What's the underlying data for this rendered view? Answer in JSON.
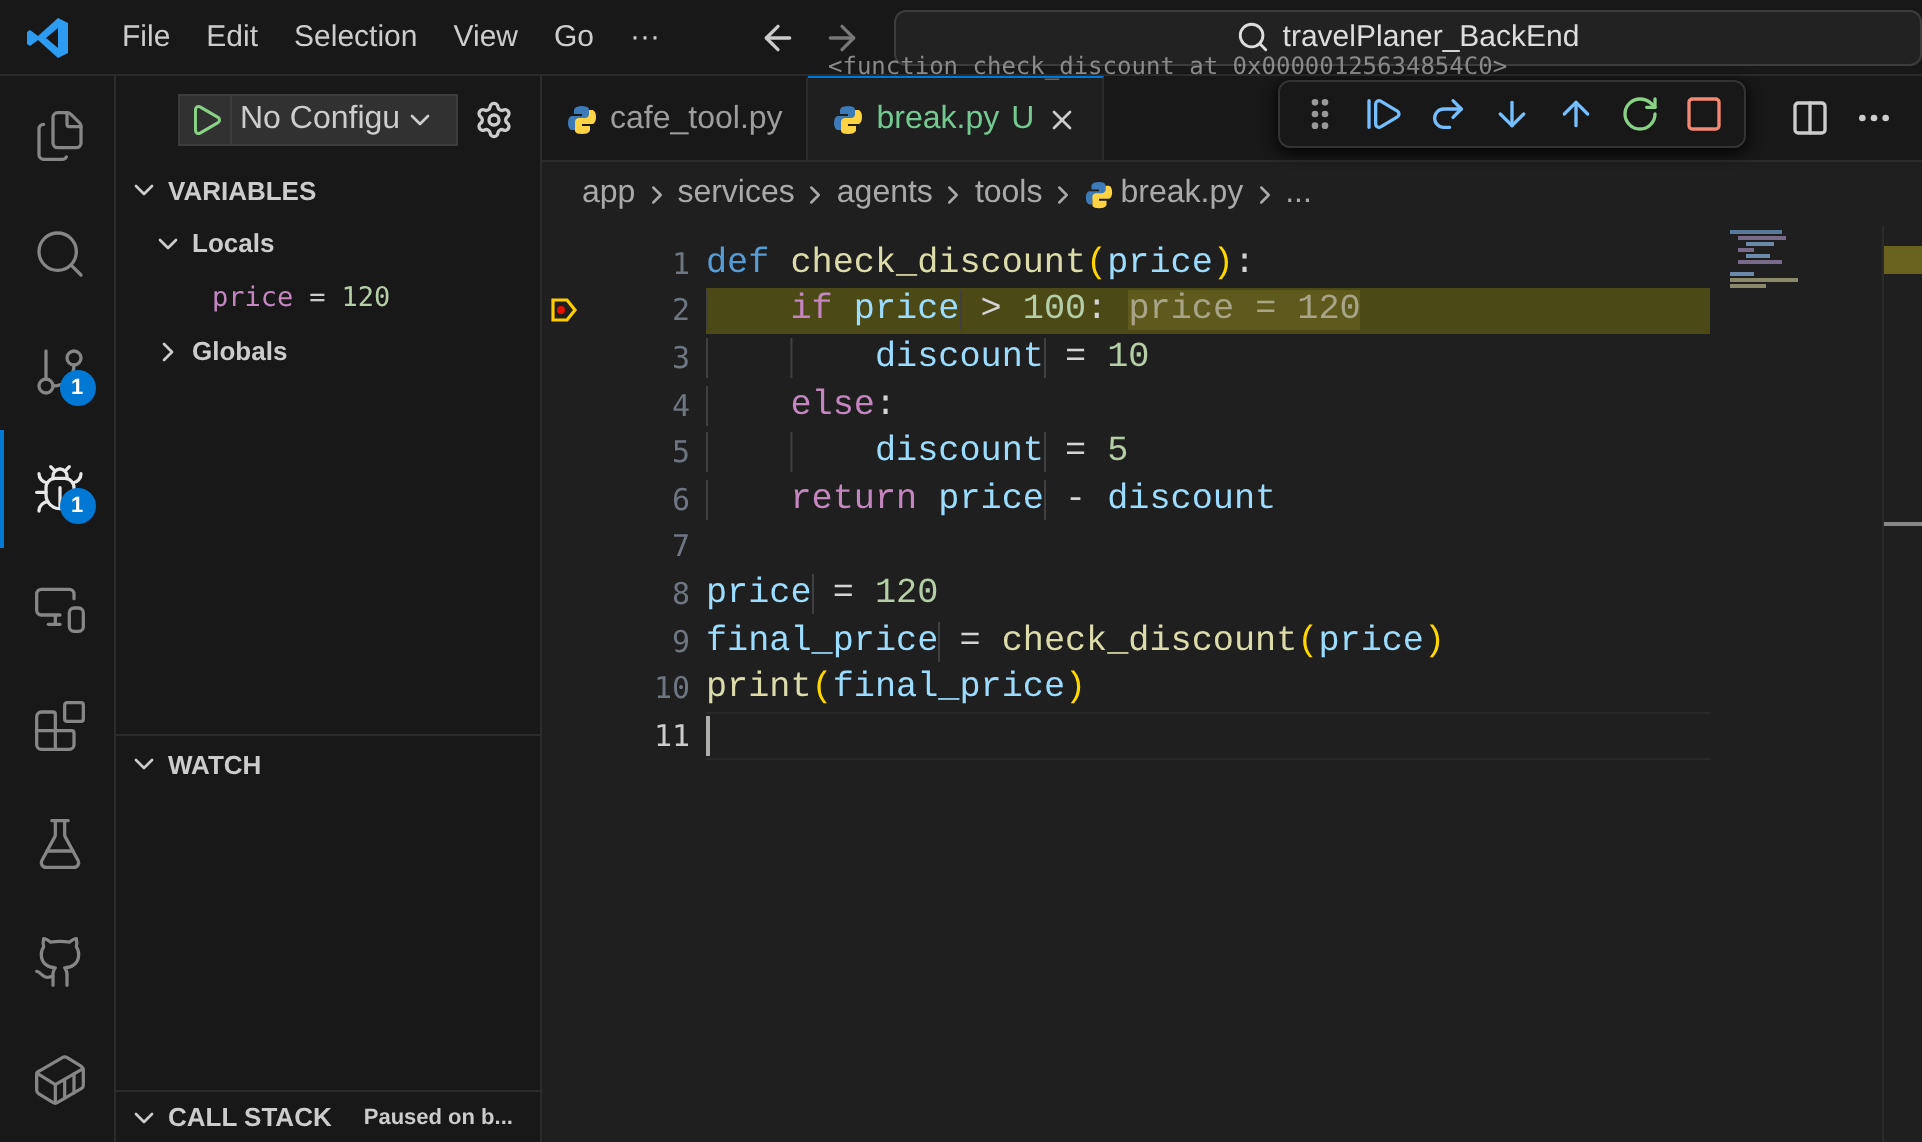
{
  "menu": [
    "File",
    "Edit",
    "Selection",
    "View",
    "Go",
    "···"
  ],
  "search": {
    "value": "travelPlaner_BackEnd"
  },
  "activity_bar": [
    {
      "kind": "explorer",
      "selected": false
    },
    {
      "kind": "search",
      "selected": false
    },
    {
      "kind": "source-control",
      "selected": false,
      "badge": "1"
    },
    {
      "kind": "run-debug",
      "selected": true,
      "badge": "1"
    },
    {
      "kind": "remote",
      "selected": false
    },
    {
      "kind": "extensions",
      "selected": false
    },
    {
      "kind": "testing",
      "selected": false
    },
    {
      "kind": "github",
      "selected": false
    },
    {
      "kind": "docker",
      "selected": false
    }
  ],
  "run_config": {
    "label": "No Configu"
  },
  "variables": {
    "title": "VARIABLES",
    "expanded": true,
    "scopes": [
      {
        "name": "Locals",
        "expanded": true,
        "children": [
          {
            "name": "price",
            "operator": "=",
            "value": "120"
          }
        ]
      },
      {
        "name": "Globals",
        "expanded": false
      }
    ]
  },
  "watch": {
    "title": "WATCH",
    "expanded": true
  },
  "call_stack": {
    "title": "CALL STACK",
    "expanded": true,
    "status": "Paused on b..."
  },
  "tabs": [
    {
      "label": "cafe_tool.py",
      "selected": false
    },
    {
      "label": "break.py",
      "selected": true,
      "status": "U"
    }
  ],
  "breadcrumbs": [
    "app",
    "services",
    "agents",
    "tools",
    "break.py",
    "..."
  ],
  "hover": {
    "text": "<function check_discount at 0x00000125634854C0>"
  },
  "debug_toolbar": [
    {
      "kind": "drag"
    },
    {
      "kind": "continue"
    },
    {
      "kind": "step-over"
    },
    {
      "kind": "step-into"
    },
    {
      "kind": "step-out"
    },
    {
      "kind": "restart"
    },
    {
      "kind": "stop"
    }
  ],
  "code": [
    {
      "number": "1",
      "current": false,
      "breakpoint": false,
      "cursor": false,
      "tokens": [
        {
          "kind": "kw",
          "text": "def "
        },
        {
          "kind": "fn",
          "text": "check_discount"
        },
        {
          "kind": "br",
          "text": "("
        },
        {
          "kind": "var",
          "text": "price"
        },
        {
          "kind": "br",
          "text": ")"
        },
        {
          "kind": "op",
          "text": ":"
        }
      ]
    },
    {
      "number": "2",
      "current": true,
      "breakpoint": true,
      "cursor": false,
      "inline_value": "price = 120",
      "tokens": [
        {
          "kind": "ctl",
          "text": "    if "
        },
        {
          "kind": "var",
          "text": "price"
        },
        {
          "kind": "op",
          "text": " > "
        },
        {
          "kind": "num",
          "text": "100"
        },
        {
          "kind": "op",
          "text": ": "
        }
      ]
    },
    {
      "number": "3",
      "current": false,
      "breakpoint": false,
      "cursor": false,
      "tokens": [
        {
          "kind": "var",
          "text": "        discount"
        },
        {
          "kind": "op",
          "text": " = "
        },
        {
          "kind": "num",
          "text": "10"
        }
      ]
    },
    {
      "number": "4",
      "current": false,
      "breakpoint": false,
      "cursor": false,
      "tokens": [
        {
          "kind": "ctl",
          "text": "    else"
        },
        {
          "kind": "op",
          "text": ":"
        }
      ]
    },
    {
      "number": "5",
      "current": false,
      "breakpoint": false,
      "cursor": false,
      "tokens": [
        {
          "kind": "var",
          "text": "        discount"
        },
        {
          "kind": "op",
          "text": " = "
        },
        {
          "kind": "num",
          "text": "5"
        }
      ]
    },
    {
      "number": "6",
      "current": false,
      "breakpoint": false,
      "cursor": false,
      "tokens": [
        {
          "kind": "ctl",
          "text": "    return "
        },
        {
          "kind": "var",
          "text": "price"
        },
        {
          "kind": "op",
          "text": " - "
        },
        {
          "kind": "var",
          "text": "discount"
        }
      ]
    },
    {
      "number": "7",
      "current": false,
      "breakpoint": false,
      "cursor": false
    },
    {
      "number": "8",
      "current": false,
      "breakpoint": false,
      "cursor": false,
      "tokens": [
        {
          "kind": "var",
          "text": "price"
        },
        {
          "kind": "op",
          "text": " = "
        },
        {
          "kind": "num",
          "text": "120"
        }
      ]
    },
    {
      "number": "9",
      "current": false,
      "breakpoint": false,
      "cursor": false,
      "tokens": [
        {
          "kind": "var",
          "text": "final_price"
        },
        {
          "kind": "op",
          "text": " = "
        },
        {
          "kind": "fn",
          "text": "check_discount"
        },
        {
          "kind": "br",
          "text": "("
        },
        {
          "kind": "var",
          "text": "price"
        },
        {
          "kind": "br",
          "text": ")"
        }
      ]
    },
    {
      "number": "10",
      "current": false,
      "breakpoint": false,
      "cursor": false,
      "tokens": [
        {
          "kind": "fn",
          "text": "print"
        },
        {
          "kind": "br",
          "text": "("
        },
        {
          "kind": "var",
          "text": "final_price"
        },
        {
          "kind": "br",
          "text": ")"
        }
      ]
    },
    {
      "number": "11",
      "current": false,
      "breakpoint": false,
      "cursor": true
    }
  ]
}
